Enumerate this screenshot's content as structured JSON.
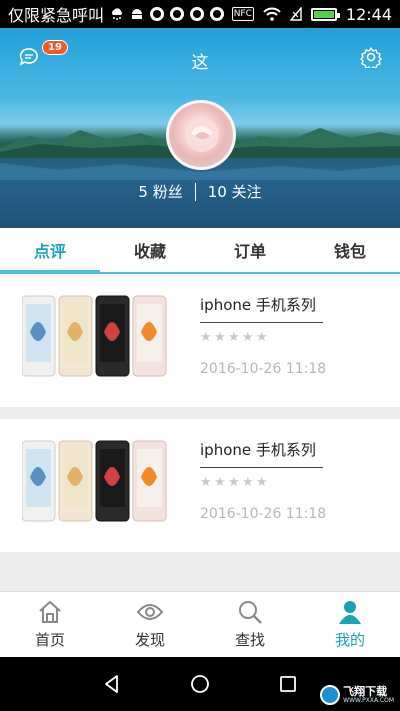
{
  "status_bar": {
    "carrier_text": "仅限紧急呼叫",
    "nfc_label": "NFC",
    "time": "12:44",
    "icons": [
      "cloud-snow-icon",
      "android-icon",
      "q-app-icon",
      "q-app-icon",
      "q-app-icon",
      "q-app-icon",
      "nfc-icon",
      "wifi-icon",
      "no-signal-icon",
      "battery-icon"
    ]
  },
  "header": {
    "title": "这",
    "message_badge": "19",
    "fans": "5 粉丝",
    "following": "10 关注"
  },
  "tabs": [
    {
      "label": "点评",
      "active": true
    },
    {
      "label": "收藏",
      "active": false
    },
    {
      "label": "订单",
      "active": false
    },
    {
      "label": "钱包",
      "active": false
    }
  ],
  "reviews": [
    {
      "title": "iphone 手机系列",
      "rating": 0,
      "max_rating": 5,
      "date": "2016-10-26 11:18"
    },
    {
      "title": "iphone 手机系列",
      "rating": 0,
      "max_rating": 5,
      "date": "2016-10-26 11:18"
    }
  ],
  "bottom_nav": [
    {
      "label": "首页",
      "icon": "home-icon",
      "active": false
    },
    {
      "label": "发现",
      "icon": "eye-icon",
      "active": false
    },
    {
      "label": "查找",
      "icon": "search-icon",
      "active": false
    },
    {
      "label": "我的",
      "icon": "user-icon",
      "active": true
    }
  ],
  "watermark": {
    "text": "飞翔下载",
    "sub": "WWW.PXXA.COM"
  },
  "colors": {
    "accent": "#1ba2b6",
    "tab_underline": "#4ec1d9",
    "badge": "#f05a28",
    "battery": "#52d14a"
  }
}
